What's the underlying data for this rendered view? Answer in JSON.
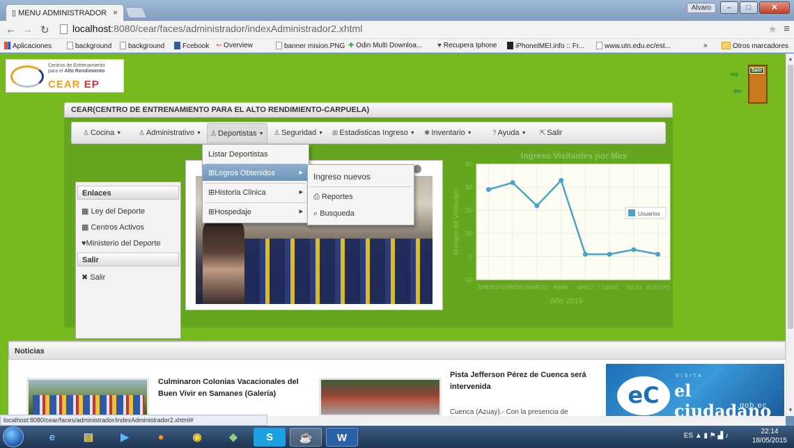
{
  "browser": {
    "tab_title": "MENU ADMINISTRADOR",
    "tab_close": "×",
    "profile": "Alvaro",
    "url_host": "localhost",
    "url_path": ":8080/cear/faces/administrador/indexAdministrador2.xhtml",
    "bookmarks": [
      "Aplicaciones",
      "background",
      "background",
      "Fcebook",
      "Overview",
      "banner mision.PNG",
      "Odin Multi Downloa...",
      "Recupera Iphone",
      "iPhoneIMEI.info :: Fr...",
      "www.utn.edu.ec/est..."
    ],
    "more_bookmarks": "»",
    "other_bookmarks": "Otros marcadores",
    "status_url": "localhost:8080/cear/faces/administrador/indexAdministrador2.xhtml#"
  },
  "logo": {
    "line1": "Centros de Entrenamiento",
    "line2": "para el",
    "line2b": "Alto Rendimiento",
    "brand": "CEAR",
    "brand_suffix": "EP"
  },
  "exit_door": {
    "label": "Salir"
  },
  "panel": {
    "title": "CEAR(CENTRO DE ENTRENAMIENTO PARA EL ALTO RENDIMIENTO-CARPUELA)"
  },
  "menubar": {
    "items": [
      "Cocina",
      "Administrativo",
      "Deportistas",
      "Seguridad",
      "Estadisticas Ingreso",
      "Inventario",
      "Ayuda",
      "Salir"
    ]
  },
  "deportistas_menu": {
    "items": [
      "Listar Deportistas",
      "Logros Obtenidos",
      "Historia Clinica",
      "Hospedaje"
    ]
  },
  "logros_submenu": {
    "items": [
      "Ingreso nuevos",
      "Reportes",
      "Busqueda"
    ]
  },
  "enlaces": {
    "header": "Enlaces",
    "items": [
      "Ley del Deporte",
      "Centros Activos",
      "Ministerio del Deporte"
    ],
    "salir_header": "Salir",
    "salir_item": "Salir"
  },
  "chart_data": {
    "type": "line",
    "title": "Ingreso Visitantes por Mes",
    "xlabel": "Año 2015",
    "ylabel": "Numero de Visitantes",
    "categories": [
      "ENERO",
      "FEBRERO",
      "MARZO",
      "ABRIL",
      "MAYO",
      "JUNIO",
      "JULIO",
      "AGOSTO"
    ],
    "series": [
      {
        "name": "Usuarios",
        "values": [
          29,
          32,
          22,
          33,
          1,
          1,
          3,
          1
        ]
      }
    ],
    "yticks": [
      40,
      30,
      20,
      10,
      0,
      -10
    ],
    "ylim": [
      -10,
      40
    ],
    "legend_position": "right",
    "line_color": "#4aa3c7"
  },
  "news": {
    "header": "Noticias",
    "item1_title": "Culminaron Colonias Vacacionales del Buen Vivir en Samanes (Galería)",
    "item2_title": "Pista Jefferson Pérez de Cuenca será intervenida",
    "item2_snippet": "Cuenca (Azuay).- Con la presencia de",
    "banner_visita": "VISITA",
    "banner_name": "el ciudadano",
    "banner_domain": ".gob.ec",
    "banner_logo": "eC"
  },
  "taskbar": {
    "lang": "ES",
    "time": "22:14",
    "date": "18/05/2015"
  }
}
